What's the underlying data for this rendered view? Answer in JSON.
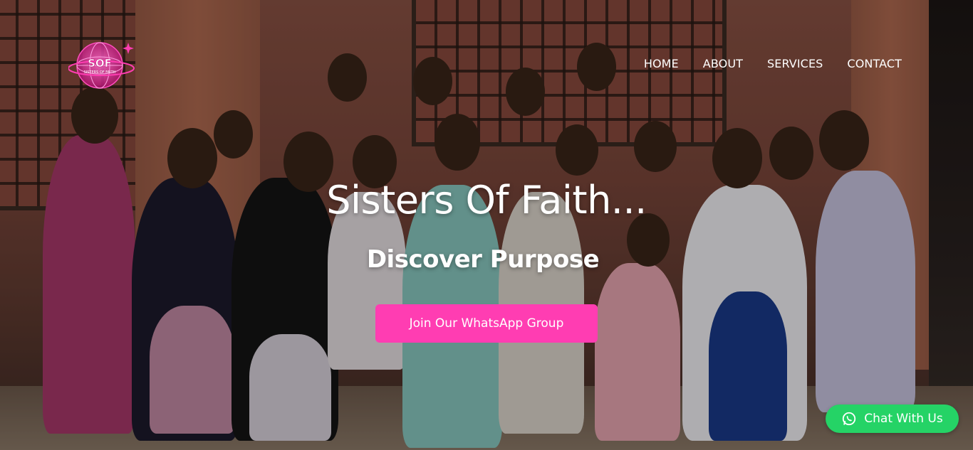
{
  "brand": {
    "logo_text": "SOF",
    "logo_subtext": "SISTERS OF FAITH",
    "accent": "#ff3db2"
  },
  "nav": {
    "items": [
      {
        "label": "HOME"
      },
      {
        "label": "ABOUT"
      },
      {
        "label": "SERVICES"
      },
      {
        "label": "CONTACT"
      }
    ]
  },
  "hero": {
    "title": "Sisters Of Faith...",
    "subtitle": "Discover Purpose",
    "cta_label": "Join Our WhatsApp Group",
    "cta_color": "#ff3db2"
  },
  "chat": {
    "label": "Chat With Us",
    "icon": "whatsapp-icon",
    "color": "#25d366"
  },
  "background": {
    "description_icon": "group-photo-background"
  }
}
